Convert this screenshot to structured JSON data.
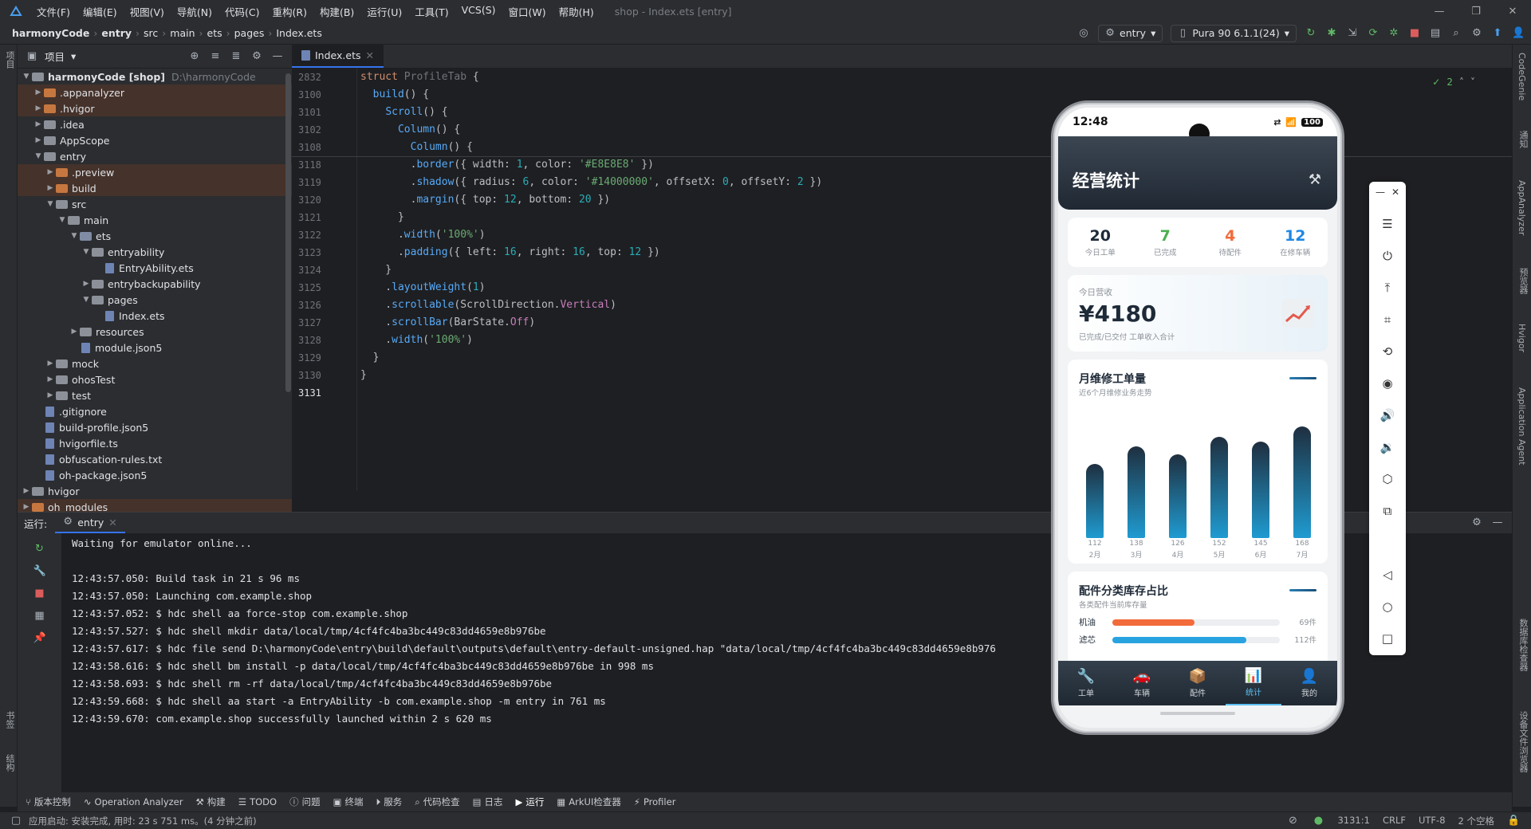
{
  "menu": {
    "items": [
      "文件(F)",
      "编辑(E)",
      "视图(V)",
      "导航(N)",
      "代码(C)",
      "重构(R)",
      "构建(B)",
      "运行(U)",
      "工具(T)",
      "VCS(S)",
      "窗口(W)",
      "帮助(H)"
    ],
    "window_title": "shop - Index.ets [entry]"
  },
  "breadcrumb": [
    "harmonyCode",
    "entry",
    "src",
    "main",
    "ets",
    "pages",
    "Index.ets"
  ],
  "run_config": "entry",
  "device": "Pura 90 6.1.1(24)",
  "left_strip": [
    "项目",
    "书签",
    "结构"
  ],
  "right_strip": [
    "CodeGenie",
    "通知",
    "AppAnalyzer",
    "预览器",
    "Hvigor",
    "Application Agent",
    "数据库检查器",
    "设备文件浏览器"
  ],
  "project": {
    "title": "项目",
    "tree": [
      {
        "d": 0,
        "arrow": "v",
        "type": "folder",
        "name": "harmonyCode [shop]",
        "extra": "D:\\harmonyCode",
        "hl": false
      },
      {
        "d": 1,
        "arrow": ">",
        "type": "folder-o",
        "name": ".appanalyzer",
        "hl": true
      },
      {
        "d": 1,
        "arrow": ">",
        "type": "folder-o",
        "name": ".hvigor",
        "hl": true
      },
      {
        "d": 1,
        "arrow": ">",
        "type": "folder",
        "name": ".idea",
        "hl": false
      },
      {
        "d": 1,
        "arrow": ">",
        "type": "folder",
        "name": "AppScope",
        "hl": false
      },
      {
        "d": 1,
        "arrow": "v",
        "type": "folder",
        "name": "entry",
        "hl": false
      },
      {
        "d": 2,
        "arrow": ">",
        "type": "folder-o",
        "name": ".preview",
        "hl": true
      },
      {
        "d": 2,
        "arrow": ">",
        "type": "folder-o",
        "name": "build",
        "hl": true
      },
      {
        "d": 2,
        "arrow": "v",
        "type": "folder",
        "name": "src",
        "hl": false
      },
      {
        "d": 3,
        "arrow": "v",
        "type": "folder",
        "name": "main",
        "hl": false
      },
      {
        "d": 4,
        "arrow": "v",
        "type": "folder-b",
        "name": "ets",
        "hl": false
      },
      {
        "d": 5,
        "arrow": "v",
        "type": "folder",
        "name": "entryability",
        "hl": false
      },
      {
        "d": 6,
        "arrow": "",
        "type": "file",
        "name": "EntryAbility.ets",
        "hl": false
      },
      {
        "d": 5,
        "arrow": ">",
        "type": "folder",
        "name": "entrybackupability",
        "hl": false
      },
      {
        "d": 5,
        "arrow": "v",
        "type": "folder",
        "name": "pages",
        "hl": false
      },
      {
        "d": 6,
        "arrow": "",
        "type": "file",
        "name": "Index.ets",
        "hl": false
      },
      {
        "d": 4,
        "arrow": ">",
        "type": "folder",
        "name": "resources",
        "hl": false
      },
      {
        "d": 4,
        "arrow": "",
        "type": "file",
        "name": "module.json5",
        "hl": false
      },
      {
        "d": 2,
        "arrow": ">",
        "type": "folder",
        "name": "mock",
        "hl": false
      },
      {
        "d": 2,
        "arrow": ">",
        "type": "folder",
        "name": "ohosTest",
        "hl": false
      },
      {
        "d": 2,
        "arrow": ">",
        "type": "folder",
        "name": "test",
        "hl": false
      },
      {
        "d": 1,
        "arrow": "",
        "type": "file",
        "name": ".gitignore",
        "hl": false
      },
      {
        "d": 1,
        "arrow": "",
        "type": "file",
        "name": "build-profile.json5",
        "hl": false
      },
      {
        "d": 1,
        "arrow": "",
        "type": "file",
        "name": "hvigorfile.ts",
        "hl": false
      },
      {
        "d": 1,
        "arrow": "",
        "type": "file",
        "name": "obfuscation-rules.txt",
        "hl": false
      },
      {
        "d": 1,
        "arrow": "",
        "type": "file",
        "name": "oh-package.json5",
        "hl": false
      },
      {
        "d": 0,
        "arrow": ">",
        "type": "folder",
        "name": "hvigor",
        "hl": false
      },
      {
        "d": 0,
        "arrow": ">",
        "type": "folder-o",
        "name": "oh_modules",
        "hl": true
      }
    ]
  },
  "editor": {
    "tab": "Index.ets",
    "inspections": "2",
    "lines": [
      {
        "n": "2832",
        "code": [
          [
            "kw",
            "struct "
          ],
          [
            "ty",
            "ProfileTab "
          ],
          [
            "",
            "{"
          ]
        ]
      },
      {
        "n": "3100",
        "code": [
          [
            "",
            "  "
          ],
          [
            "fn",
            "build"
          ],
          [
            "",
            "() {"
          ]
        ]
      },
      {
        "n": "3101",
        "code": [
          [
            "",
            "    "
          ],
          [
            "fn",
            "Scroll"
          ],
          [
            "",
            "() {"
          ]
        ]
      },
      {
        "n": "3102",
        "code": [
          [
            "",
            "      "
          ],
          [
            "fn",
            "Column"
          ],
          [
            "",
            "() {"
          ]
        ]
      },
      {
        "n": "3108",
        "code": [
          [
            "",
            "        "
          ],
          [
            "fn",
            "Column"
          ],
          [
            "",
            "() {"
          ]
        ]
      },
      {
        "n": "3118",
        "code": [
          [
            "",
            "        ."
          ],
          [
            "fn",
            "border"
          ],
          [
            "",
            "({ "
          ],
          [
            "",
            "width: "
          ],
          [
            "nm",
            "1"
          ],
          [
            "",
            ", color: "
          ],
          [
            "st",
            "'#E8E8E8'"
          ],
          [
            "",
            " })"
          ]
        ]
      },
      {
        "n": "3119",
        "code": [
          [
            "",
            "        ."
          ],
          [
            "fn",
            "shadow"
          ],
          [
            "",
            "({ radius: "
          ],
          [
            "nm",
            "6"
          ],
          [
            "",
            ", color: "
          ],
          [
            "st",
            "'#14000000'"
          ],
          [
            "",
            ", offsetX: "
          ],
          [
            "nm",
            "0"
          ],
          [
            "",
            ", offsetY: "
          ],
          [
            "nm",
            "2"
          ],
          [
            "",
            " })"
          ]
        ]
      },
      {
        "n": "3120",
        "code": [
          [
            "",
            "        ."
          ],
          [
            "fn",
            "margin"
          ],
          [
            "",
            "({ top: "
          ],
          [
            "nm",
            "12"
          ],
          [
            "",
            ", bottom: "
          ],
          [
            "nm",
            "20"
          ],
          [
            "",
            " })"
          ]
        ]
      },
      {
        "n": "3121",
        "code": [
          [
            "",
            "      }"
          ]
        ]
      },
      {
        "n": "3122",
        "code": [
          [
            "",
            "      ."
          ],
          [
            "fn",
            "width"
          ],
          [
            "",
            "("
          ],
          [
            "st",
            "'100%'"
          ],
          [
            "",
            ")"
          ]
        ]
      },
      {
        "n": "3123",
        "code": [
          [
            "",
            "      ."
          ],
          [
            "fn",
            "padding"
          ],
          [
            "",
            "({ left: "
          ],
          [
            "nm",
            "16"
          ],
          [
            "",
            ", right: "
          ],
          [
            "nm",
            "16"
          ],
          [
            "",
            ", top: "
          ],
          [
            "nm",
            "12"
          ],
          [
            "",
            " })"
          ]
        ]
      },
      {
        "n": "3124",
        "code": [
          [
            "",
            "    }"
          ]
        ]
      },
      {
        "n": "3125",
        "code": [
          [
            "",
            "    ."
          ],
          [
            "fn",
            "layoutWeight"
          ],
          [
            "",
            "("
          ],
          [
            "nm",
            "1"
          ],
          [
            "",
            ")"
          ]
        ]
      },
      {
        "n": "3126",
        "code": [
          [
            "",
            "    ."
          ],
          [
            "fn",
            "scrollable"
          ],
          [
            "",
            "(ScrollDirection."
          ],
          [
            "pr",
            "Vertical"
          ],
          [
            "",
            ")"
          ]
        ]
      },
      {
        "n": "3127",
        "code": [
          [
            "",
            "    ."
          ],
          [
            "fn",
            "scrollBar"
          ],
          [
            "",
            "(BarState."
          ],
          [
            "pr",
            "Off"
          ],
          [
            "",
            ")"
          ]
        ]
      },
      {
        "n": "3128",
        "code": [
          [
            "",
            "    ."
          ],
          [
            "fn",
            "width"
          ],
          [
            "",
            "("
          ],
          [
            "st",
            "'100%'"
          ],
          [
            "",
            ")"
          ]
        ]
      },
      {
        "n": "3129",
        "code": [
          [
            "",
            "  }"
          ]
        ]
      },
      {
        "n": "3130",
        "code": [
          [
            "",
            "}"
          ]
        ]
      },
      {
        "n": "3131",
        "code": [
          [
            "",
            ""
          ]
        ]
      }
    ]
  },
  "run": {
    "label": "运行:",
    "tab": "entry",
    "console": [
      "Waiting for emulator online...",
      "",
      "12:43:57.050: Build task in 21 s 96 ms",
      "12:43:57.050: Launching com.example.shop",
      "12:43:57.052: $ hdc shell aa force-stop com.example.shop",
      "12:43:57.527: $ hdc shell mkdir data/local/tmp/4cf4fc4ba3bc449c83dd4659e8b976be",
      "12:43:57.617: $ hdc file send D:\\harmonyCode\\entry\\build\\default\\outputs\\default\\entry-default-unsigned.hap \"data/local/tmp/4cf4fc4ba3bc449c83dd4659e8b976",
      "12:43:58.616: $ hdc shell bm install -p data/local/tmp/4cf4fc4ba3bc449c83dd4659e8b976be in 998 ms",
      "12:43:58.693: $ hdc shell rm -rf data/local/tmp/4cf4fc4ba3bc449c83dd4659e8b976be",
      "12:43:59.668: $ hdc shell aa start -a EntryAbility -b com.example.shop -m entry in 761 ms",
      "12:43:59.670: com.example.shop successfully launched within 2 s 620 ms"
    ]
  },
  "bottom_tools": [
    "版本控制",
    "Operation Analyzer",
    "构建",
    "TODO",
    "问题",
    "终端",
    "服务",
    "代码检查",
    "日志",
    "运行",
    "ArkUI检查器",
    "Profiler"
  ],
  "status": {
    "left": "应用启动: 安装完成, 用时: 23 s 751 ms。(4 分钟之前)",
    "pos": "3131:1",
    "eol": "CRLF",
    "enc": "UTF-8",
    "indent": "2 个空格"
  },
  "phone": {
    "time": "12:48",
    "battery": "100",
    "title": "经营统计",
    "stats": [
      {
        "v": "20",
        "l": "今日工单",
        "c": "#1e2a38"
      },
      {
        "v": "7",
        "l": "已完成",
        "c": "#4caf50"
      },
      {
        "v": "4",
        "l": "待配件",
        "c": "#f26b3a"
      },
      {
        "v": "12",
        "l": "在修车辆",
        "c": "#1e88e5"
      }
    ],
    "revenue": {
      "label": "今日营收",
      "value": "¥4180",
      "sub": "已完成/已交付 工单收入合计"
    },
    "chart_title": "月维修工单量",
    "chart_sub": "近6个月维修业务走势",
    "chart_data": {
      "type": "bar",
      "categories": [
        "2月",
        "3月",
        "4月",
        "5月",
        "6月",
        "7月"
      ],
      "values": [
        112,
        138,
        126,
        152,
        145,
        168
      ]
    },
    "parts_title": "配件分类库存占比",
    "parts_sub": "各类配件当前库存量",
    "parts": [
      {
        "name": "机油",
        "pct": "69件",
        "ratio": 0.49,
        "color": "#f26b3a"
      },
      {
        "name": "滤芯",
        "pct": "112件",
        "ratio": 0.8,
        "color": "#29a3e0"
      }
    ],
    "nav": [
      {
        "label": "工单",
        "icon": "🔧"
      },
      {
        "label": "车辆",
        "icon": "🚗"
      },
      {
        "label": "配件",
        "icon": "📦"
      },
      {
        "label": "统计",
        "icon": "📊"
      },
      {
        "label": "我的",
        "icon": "👤"
      }
    ]
  }
}
